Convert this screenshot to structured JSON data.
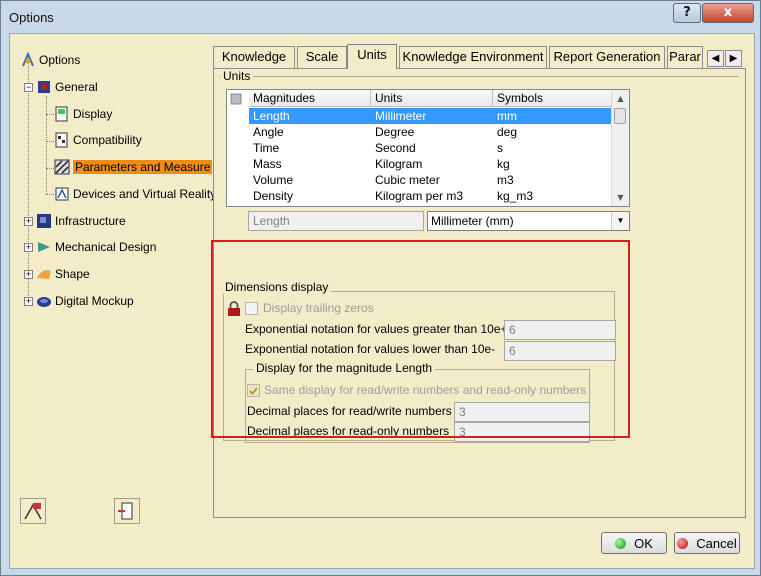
{
  "window": {
    "title": "Options",
    "help_label": "?",
    "close_label": "x"
  },
  "tree": {
    "root": "Options",
    "general": "General",
    "display": "Display",
    "compatibility": "Compatibility",
    "parameters": "Parameters and Measure",
    "devices": "Devices and Virtual Reality",
    "infrastructure": "Infrastructure",
    "mechanical": "Mechanical Design",
    "shape": "Shape",
    "mockup": "Digital Mockup"
  },
  "tabs": [
    "Knowledge",
    "Scale",
    "Units",
    "Knowledge Environment",
    "Report Generation",
    "Parar"
  ],
  "units": {
    "group_label": "Units",
    "columns": [
      "Magnitudes",
      "Units",
      "Symbols"
    ],
    "rows": [
      [
        "Length",
        "Millimeter",
        "mm"
      ],
      [
        "Angle",
        "Degree",
        "deg"
      ],
      [
        "Time",
        "Second",
        "s"
      ],
      [
        "Mass",
        "Kilogram",
        "kg"
      ],
      [
        "Volume",
        "Cubic meter",
        "m3"
      ],
      [
        "Density",
        "Kilogram per m3",
        "kg_m3"
      ]
    ],
    "current_magnitude": "Length",
    "current_unit": "Millimeter (mm)"
  },
  "dimensions": {
    "group_label": "Dimensions display",
    "trailing_zeros": "Display trailing zeros",
    "exp_greater_label": "Exponential notation for values greater than 10e+",
    "exp_greater_value": "6",
    "exp_lower_label": "Exponential notation for values lower than 10e-",
    "exp_lower_value": "6",
    "magnitude_group": "Display for the magnitude Length",
    "same_display": "Same display for read/write numbers and read-only numbers",
    "rw_label": "Decimal places for read/write numbers",
    "rw_value": "3",
    "ro_label": "Decimal places for read-only numbers",
    "ro_value": "3"
  },
  "buttons": {
    "ok": "OK",
    "cancel": "Cancel"
  },
  "colors": {
    "accent_selection": "#3399ff",
    "tree_selection": "#f28c10",
    "highlight": "#d91c1c"
  }
}
